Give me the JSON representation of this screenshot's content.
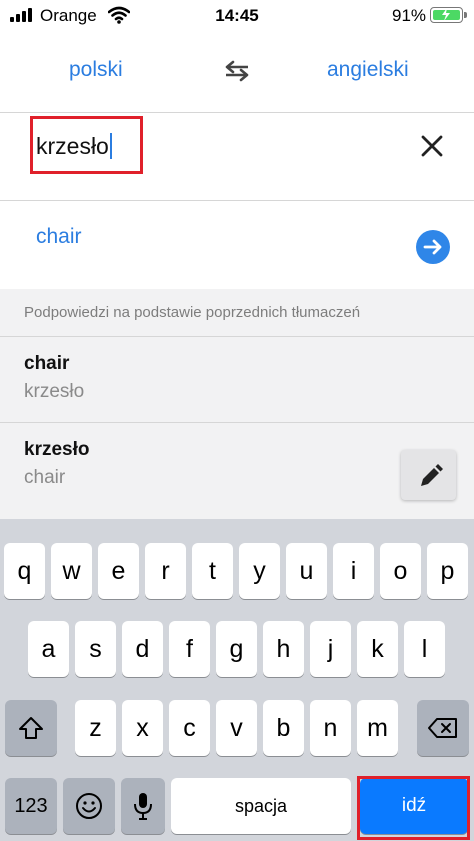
{
  "status_bar": {
    "carrier": "Orange",
    "time": "14:45",
    "battery": "91%"
  },
  "languages": {
    "source": "polski",
    "target": "angielski"
  },
  "input": {
    "text": "krzesło"
  },
  "result": {
    "text": "chair"
  },
  "suggestions": {
    "header": "Podpowiedzi na podstawie poprzednich tłumaczeń",
    "items": [
      {
        "word": "chair",
        "translation": "krzesło"
      },
      {
        "word": "krzesło",
        "translation": "chair"
      }
    ]
  },
  "keyboard": {
    "row1": [
      "q",
      "w",
      "e",
      "r",
      "t",
      "y",
      "u",
      "i",
      "o",
      "p"
    ],
    "row2": [
      "a",
      "s",
      "d",
      "f",
      "g",
      "h",
      "j",
      "k",
      "l"
    ],
    "row3": [
      "z",
      "x",
      "c",
      "v",
      "b",
      "n",
      "m"
    ],
    "numbers_key": "123",
    "space_key": "spacja",
    "go_key": "idź"
  },
  "colors": {
    "accent": "#2b7de0",
    "highlight": "#e0202a",
    "go_key": "#0a7aff"
  }
}
